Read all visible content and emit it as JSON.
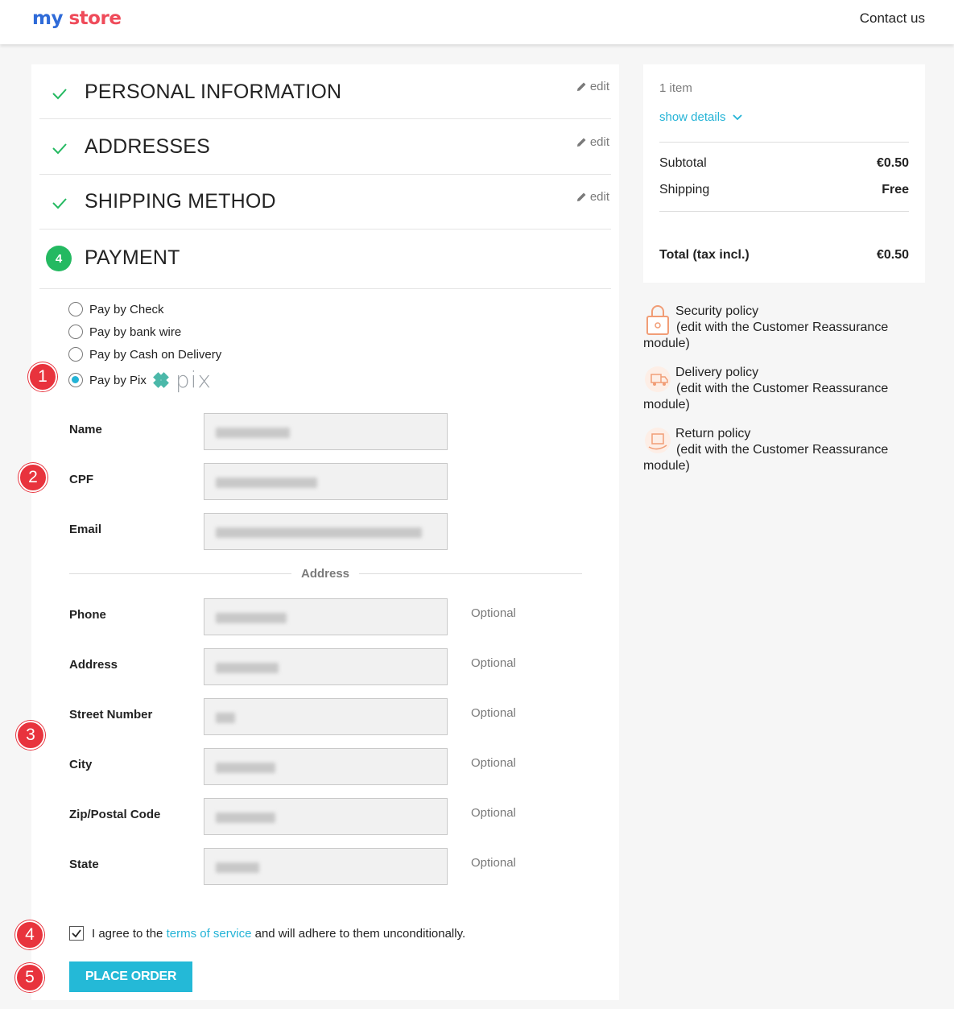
{
  "header": {
    "logo_part1": "my",
    "logo_part2": "store",
    "contact": "Contact us"
  },
  "steps": {
    "personal": {
      "title": "PERSONAL INFORMATION",
      "edit": "edit"
    },
    "addresses": {
      "title": "ADDRESSES",
      "edit": "edit"
    },
    "shipping": {
      "title": "SHIPPING METHOD",
      "edit": "edit"
    },
    "payment": {
      "number": "4",
      "title": "PAYMENT"
    }
  },
  "payment_options": [
    {
      "label": "Pay by Check",
      "selected": false
    },
    {
      "label": "Pay by bank wire",
      "selected": false
    },
    {
      "label": "Pay by Cash on Delivery",
      "selected": false
    },
    {
      "label": "Pay by Pix",
      "selected": true
    }
  ],
  "pix_logo_text": "pix",
  "form": {
    "name_label": "Name",
    "cpf_label": "CPF",
    "email_label": "Email",
    "address_section": "Address",
    "phone_label": "Phone",
    "address_label": "Address",
    "street_number_label": "Street Number",
    "city_label": "City",
    "zip_label": "Zip/Postal Code",
    "state_label": "State",
    "optional": "Optional"
  },
  "agree": {
    "before": "I agree to the ",
    "link": "terms of service",
    "after": " and will adhere to them unconditionally.",
    "checked": true
  },
  "place_order": "PLACE ORDER",
  "summary": {
    "items": "1 item",
    "show_details": "show details",
    "subtotal_label": "Subtotal",
    "subtotal_value": "€0.50",
    "shipping_label": "Shipping",
    "shipping_value": "Free",
    "total_label": "Total (tax incl.)",
    "total_value": "€0.50"
  },
  "reassurance": [
    {
      "title": "Security policy",
      "desc": "(edit with the Customer Reassurance",
      "desc2": "module)",
      "icon": "lock-icon"
    },
    {
      "title": "Delivery policy",
      "desc": "(edit with the Customer Reassurance",
      "desc2": "module)",
      "icon": "truck-icon"
    },
    {
      "title": "Return policy",
      "desc": "(edit with the Customer Reassurance",
      "desc2": "module)",
      "icon": "return-box-icon"
    }
  ],
  "markers": [
    "1",
    "2",
    "3",
    "4",
    "5"
  ],
  "colors": {
    "accent": "#24b3d6",
    "success": "#24b961",
    "marker": "#e8333d"
  }
}
